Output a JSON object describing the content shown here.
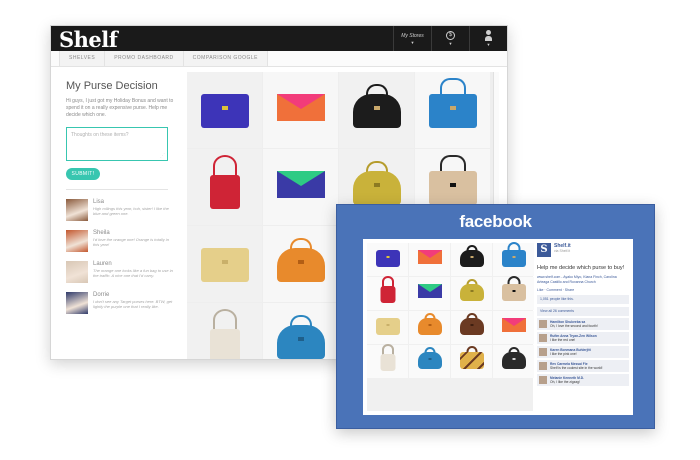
{
  "shelf": {
    "logo": "Shelf",
    "topnav": {
      "my_stores": "My Stores",
      "currency_icon": "dollar-icon",
      "account_icon": "person-icon"
    },
    "tabs": [
      "SHELVES",
      "PROMO DASHBOARD",
      "COMPARISON GOOGLE"
    ],
    "title": "My Purse Decision",
    "description": "Hi guys, I just got my Holiday Bonus and want to spend it on a really expensive purse. Help me decide which one.",
    "textarea_placeholder": "Thoughts on these items?",
    "submit_label": "SUBMIT!",
    "comments": [
      {
        "name": "Lisa",
        "text": "High rollings this year, huh, sister! I like the blue and green one.",
        "avatar_color": "#8a5a3c"
      },
      {
        "name": "Sheila",
        "text": "I'd love the orange one! Orange is totally in this year!",
        "avatar_color": "#c3572e"
      },
      {
        "name": "Lauren",
        "text": "The orange one looks like a fun bag to use in the traffic. A nice one that I'd carry.",
        "avatar_color": "#d8c7b5"
      },
      {
        "name": "Dorrie",
        "text": "I don't see any Target purses here. BTW, get lightly the purple one that I really like.",
        "avatar_color": "#2f3a6a"
      }
    ],
    "grid": [
      {
        "kind": "clutch",
        "color": "#3d34b8",
        "accent": "#ddc33a",
        "handle": "#3d34b8"
      },
      {
        "kind": "envelope",
        "color": "#f0703a",
        "accent": "#f23c7a"
      },
      {
        "kind": "dome",
        "color": "#1c1c1c",
        "accent": "#c9a86b",
        "handle": "#1c1c1c"
      },
      {
        "kind": "tote",
        "color": "#2b83c9",
        "accent": "#c9a86b",
        "handle": "#2b83c9"
      },
      {
        "kind": "hanging",
        "color": "#cf2436",
        "accent": "#cf2436",
        "handle": "#cf2436"
      },
      {
        "kind": "envelope",
        "color": "#3a3aa6",
        "accent": "#2ecb84"
      },
      {
        "kind": "dome",
        "color": "#c9b23a",
        "accent": "#8c7a22",
        "handle": "#b59c2c"
      },
      {
        "kind": "tote",
        "color": "#d9c0a0",
        "accent": "#111111",
        "handle": "#2a2a2a"
      },
      {
        "kind": "clutch",
        "color": "#e5cf8a",
        "accent": "#c9b06a",
        "handle": "#e5cf8a"
      },
      {
        "kind": "dome",
        "color": "#e88a2c",
        "accent": "#b35e14",
        "handle": "#e88a2c"
      },
      {
        "kind": "empty",
        "color": "#f4f4f4",
        "accent": "#f4f4f4"
      },
      {
        "kind": "empty",
        "color": "#f4f4f4",
        "accent": "#f4f4f4"
      },
      {
        "kind": "hanging",
        "color": "#e9e2d6",
        "accent": "#cfc6b6",
        "handle": "#b9b0a0"
      },
      {
        "kind": "dome",
        "color": "#2c86c0",
        "accent": "#1f5f8a",
        "handle": "#2c86c0"
      },
      {
        "kind": "empty",
        "color": "#f4f4f4",
        "accent": "#f4f4f4"
      },
      {
        "kind": "empty",
        "color": "#f4f4f4",
        "accent": "#f4f4f4"
      }
    ]
  },
  "facebook": {
    "logo": "facebook",
    "grid": [
      {
        "kind": "clutch",
        "color": "#3d34b8",
        "accent": "#ddc33a",
        "handle": "#3d34b8"
      },
      {
        "kind": "envelope",
        "color": "#f0703a",
        "accent": "#f23c7a"
      },
      {
        "kind": "dome",
        "color": "#1c1c1c",
        "accent": "#c9a86b",
        "handle": "#1c1c1c"
      },
      {
        "kind": "tote",
        "color": "#2b83c9",
        "accent": "#c9a86b",
        "handle": "#2b83c9"
      },
      {
        "kind": "hanging",
        "color": "#cf2436",
        "accent": "#cf2436",
        "handle": "#cf2436"
      },
      {
        "kind": "envelope",
        "color": "#3a3aa6",
        "accent": "#2ecb84"
      },
      {
        "kind": "dome",
        "color": "#c9b23a",
        "accent": "#8c7a22",
        "handle": "#b59c2c"
      },
      {
        "kind": "tote",
        "color": "#d9c0a0",
        "accent": "#111111",
        "handle": "#2a2a2a"
      },
      {
        "kind": "clutch",
        "color": "#e5cf8a",
        "accent": "#c9b06a",
        "handle": "#e5cf8a"
      },
      {
        "kind": "dome",
        "color": "#e88a2c",
        "accent": "#b35e14",
        "handle": "#e88a2c"
      },
      {
        "kind": "dome",
        "color": "#6b3a22",
        "accent": "#3f1f10",
        "handle": "#6b3a22"
      },
      {
        "kind": "envelope",
        "color": "#f0703a",
        "accent": "#f23c7a"
      },
      {
        "kind": "hanging",
        "color": "#e9e2d6",
        "accent": "#cfc6b6",
        "handle": "#b9b0a0"
      },
      {
        "kind": "dome",
        "color": "#2c86c0",
        "accent": "#1f5f8a",
        "handle": "#2c86c0"
      },
      {
        "kind": "zigzag",
        "color": "#e0b14a",
        "accent": "#6b3a22",
        "handle": "#6b3a22"
      },
      {
        "kind": "dome",
        "color": "#2a2a2a",
        "accent": "#d4d4d4",
        "handle": "#2a2a2a"
      }
    ],
    "post": {
      "page_name": "Shelf.it",
      "page_meta": "via Shelf.it",
      "question": "Help me decide which purse to buy!",
      "link": "www.shelf.com - Ayako Miyo, Kiana Finch, Carolina Arteaga Castillo and Roxanna Church",
      "actions": "Like · Comment · Share",
      "likes": "1,051 people like this.",
      "comment_count": "View all 26 comments",
      "comments": [
        {
          "author": "Hamilton Shukeeba sa",
          "text": "Oh, I love the second and fourth!"
        },
        {
          "author": "Rufim Anna Tryan-Zen Wilson",
          "text": "I like the red one!"
        },
        {
          "author": "Karen Bonmana Buhlerjitt",
          "text": "I like the pink one!"
        },
        {
          "author": "Rev Carmela Messai Fie",
          "text": "Shelf is the coolest site in the world!"
        },
        {
          "author": "Melanie Kenneth M.D.",
          "text": "Oh, I like the zigzag!"
        }
      ]
    }
  }
}
